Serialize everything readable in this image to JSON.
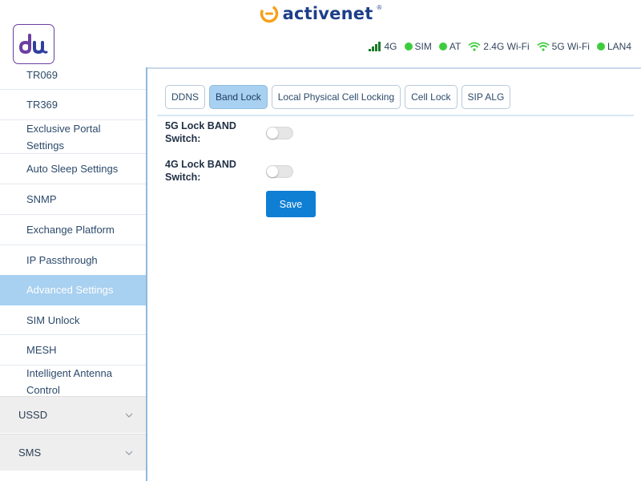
{
  "brand": {
    "name": "activenet",
    "reg_mark": "®",
    "logo_icon": "activenet-logo-icon"
  },
  "header": {
    "logo_text": "du",
    "logo_color": "#6b3fa0",
    "status": [
      {
        "icon": "signal-bars-icon",
        "label": "4G"
      },
      {
        "icon": "green-dot-icon",
        "label": "SIM"
      },
      {
        "icon": "green-dot-icon",
        "label": "AT"
      },
      {
        "icon": "wifi-icon",
        "label": "2.4G Wi-Fi"
      },
      {
        "icon": "wifi-icon",
        "label": "5G Wi-Fi"
      },
      {
        "icon": "green-dot-icon",
        "label": "LAN4"
      }
    ]
  },
  "sidebar": {
    "items": [
      {
        "label": "TR069"
      },
      {
        "label": "TR369"
      },
      {
        "label": "Exclusive Portal Settings"
      },
      {
        "label": "Auto Sleep Settings"
      },
      {
        "label": "SNMP"
      },
      {
        "label": "Exchange Platform"
      },
      {
        "label": "IP Passthrough"
      },
      {
        "label": "Advanced Settings",
        "active": true
      },
      {
        "label": "SIM Unlock"
      },
      {
        "label": "MESH"
      },
      {
        "label": "Intelligent Antenna Control"
      }
    ],
    "groups": [
      {
        "label": "USSD"
      },
      {
        "label": "SMS"
      }
    ]
  },
  "main": {
    "tabs": [
      {
        "label": "DDNS"
      },
      {
        "label": "Band Lock",
        "active": true
      },
      {
        "label": "Local Physical Cell Locking"
      },
      {
        "label": "Cell Lock"
      },
      {
        "label": "SIP ALG"
      }
    ],
    "form": {
      "lock_5g_label": "5G Lock BAND Switch:",
      "lock_5g_enabled": false,
      "lock_4g_label": "4G Lock BAND Switch:",
      "lock_4g_enabled": false,
      "save_label": "Save"
    }
  },
  "colors": {
    "accent": "#0f7fd4",
    "active_bg": "#a8d0f0",
    "status_green": "#3ecc3e",
    "brand_orange": "#f5a01a",
    "brand_blue": "#1d3e8a"
  }
}
